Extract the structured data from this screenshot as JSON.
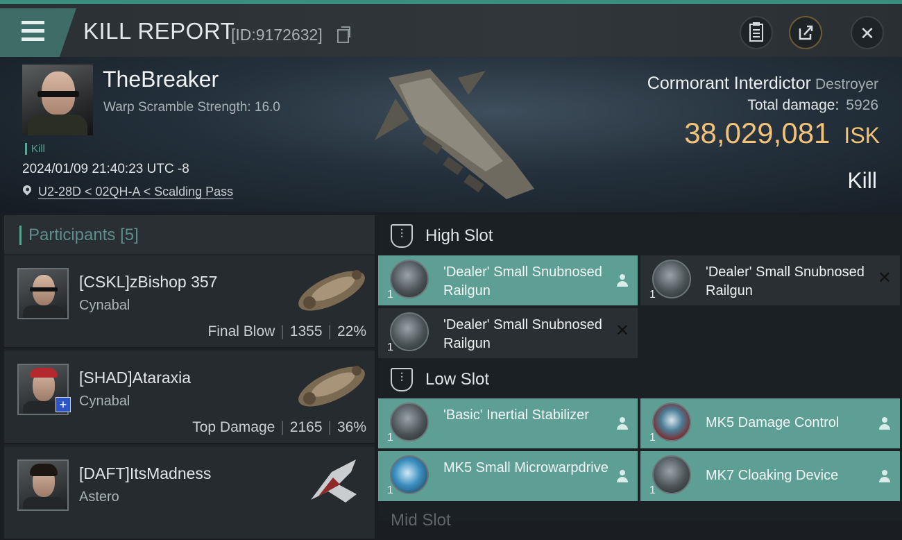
{
  "header": {
    "title": "KILL REPORT",
    "report_id": "[ID:9172632]"
  },
  "victim": {
    "name": "TheBreaker",
    "warp_scramble": "Warp Scramble Strength: 16.0",
    "tag": "Kill",
    "datetime": "2024/01/09 21:40:23 UTC -8",
    "location": "U2-28D < 02QH-A < Scalding Pass",
    "ship_name": "Cormorant Interdictor",
    "ship_class": "Destroyer",
    "total_damage_label": "Total damage:",
    "total_damage_value": "5926",
    "isk_value": "38,029,081",
    "isk_unit": "ISK",
    "result": "Kill"
  },
  "participants": {
    "label": "Participants",
    "count": "[5]",
    "rows": [
      {
        "name": "[CSKL]zBishop 357",
        "ship": "Cynabal",
        "role": "Final Blow",
        "damage": "1355",
        "percent": "22%"
      },
      {
        "name": "[SHAD]Ataraxia",
        "ship": "Cynabal",
        "role": "Top Damage",
        "damage": "2165",
        "percent": "36%"
      },
      {
        "name": "[DAFT]ItsMadness",
        "ship": "Astero",
        "role": "",
        "damage": "",
        "percent": ""
      }
    ]
  },
  "slots": {
    "high": {
      "label": "High Slot",
      "modules": [
        {
          "name": "'Dealer' Small Snubnosed Railgun",
          "qty": "1",
          "state": "fitted"
        },
        {
          "name": "'Dealer' Small Snubnosed Railgun",
          "qty": "1",
          "state": "destroyed"
        },
        {
          "name": "'Dealer' Small Snubnosed Railgun",
          "qty": "1",
          "state": "destroyed"
        }
      ]
    },
    "low": {
      "label": "Low Slot",
      "modules": [
        {
          "name": "'Basic' Inertial Stabilizer",
          "qty": "1",
          "state": "fitted"
        },
        {
          "name": "MK5 Damage Control",
          "qty": "1",
          "state": "fitted"
        },
        {
          "name": "MK5 Small Microwarpdrive",
          "qty": "1",
          "state": "fitted"
        },
        {
          "name": "MK7 Cloaking Device",
          "qty": "1",
          "state": "fitted"
        }
      ]
    },
    "mid": {
      "label": "Mid Slot"
    }
  },
  "icons": {
    "menu": "menu-icon",
    "clipboard": "clipboard-icon",
    "share": "share-icon",
    "close": "close-icon",
    "location": "location-pin-icon",
    "copy": "copy-icon",
    "slot": "slot-shield-icon",
    "pilot": "person-icon"
  },
  "colors": {
    "accent": "#5aa493",
    "isk": "#f1c277",
    "fitted_bg": "#5d9e95",
    "destroyed_bg": "#2a2f33"
  }
}
